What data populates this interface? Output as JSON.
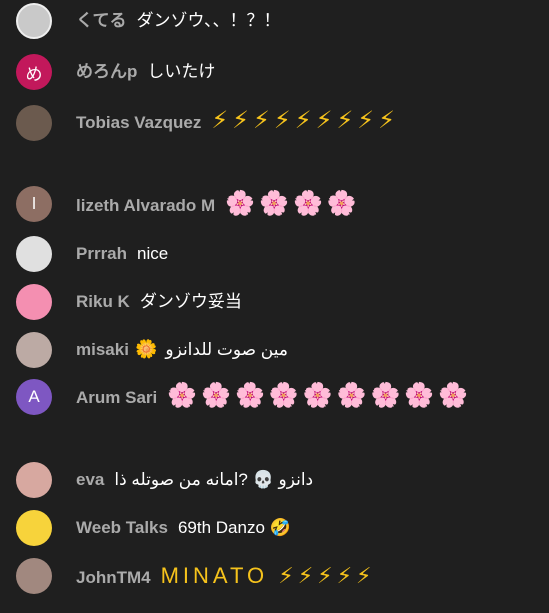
{
  "colors": {
    "background": "#1f1f1f",
    "author": "#aaaaaa",
    "message": "#ffffff"
  },
  "messages": [
    {
      "author": "くてる",
      "text": "ダンゾウ、、！？！",
      "avatar": {
        "letter": "",
        "color": "#c9c9c9"
      }
    },
    {
      "author": "めろんp",
      "text": "しいたけ",
      "avatar": {
        "letter": "め",
        "color": "#c2185b"
      }
    },
    {
      "author": "Tobias Vazquez",
      "text": "⚡⚡⚡⚡⚡⚡⚡⚡⚡",
      "avatar": {
        "letter": "",
        "color": "#6b5a4e"
      }
    },
    {
      "author": "lizeth Alvarado M",
      "text": "🌸🌸🌸🌸",
      "avatar": {
        "letter": "l",
        "color": "#8d6e63"
      }
    },
    {
      "author": "Prrrah",
      "text": "nice",
      "avatar": {
        "letter": "",
        "color": "#e0e0e0"
      }
    },
    {
      "author": "Riku K",
      "text": "ダンゾウ妥当",
      "avatar": {
        "letter": "",
        "color": "#f48fb1"
      }
    },
    {
      "author": "misaki",
      "badge": "🌼",
      "text": "مين صوت للدانزو",
      "avatar": {
        "letter": "",
        "color": "#bcaaa4"
      }
    },
    {
      "author": "Arum Sari",
      "text": "🌸🌸🌸🌸🌸🌸🌸🌸🌸",
      "avatar": {
        "letter": "A",
        "color": "#7e57c2"
      }
    },
    {
      "author": "eva",
      "text": "دانزو 💀 ?امانه من صوتله ذا",
      "avatar": {
        "letter": "",
        "color": "#d7a8a0"
      }
    },
    {
      "author": "Weeb Talks",
      "text": "69th Danzo 🤣",
      "avatar": {
        "letter": "",
        "color": "#f7d33b"
      }
    },
    {
      "author": "JohnTM4",
      "text": "MINATO ⚡⚡⚡⚡⚡",
      "avatar": {
        "letter": "",
        "color": "#a1887f"
      }
    }
  ]
}
